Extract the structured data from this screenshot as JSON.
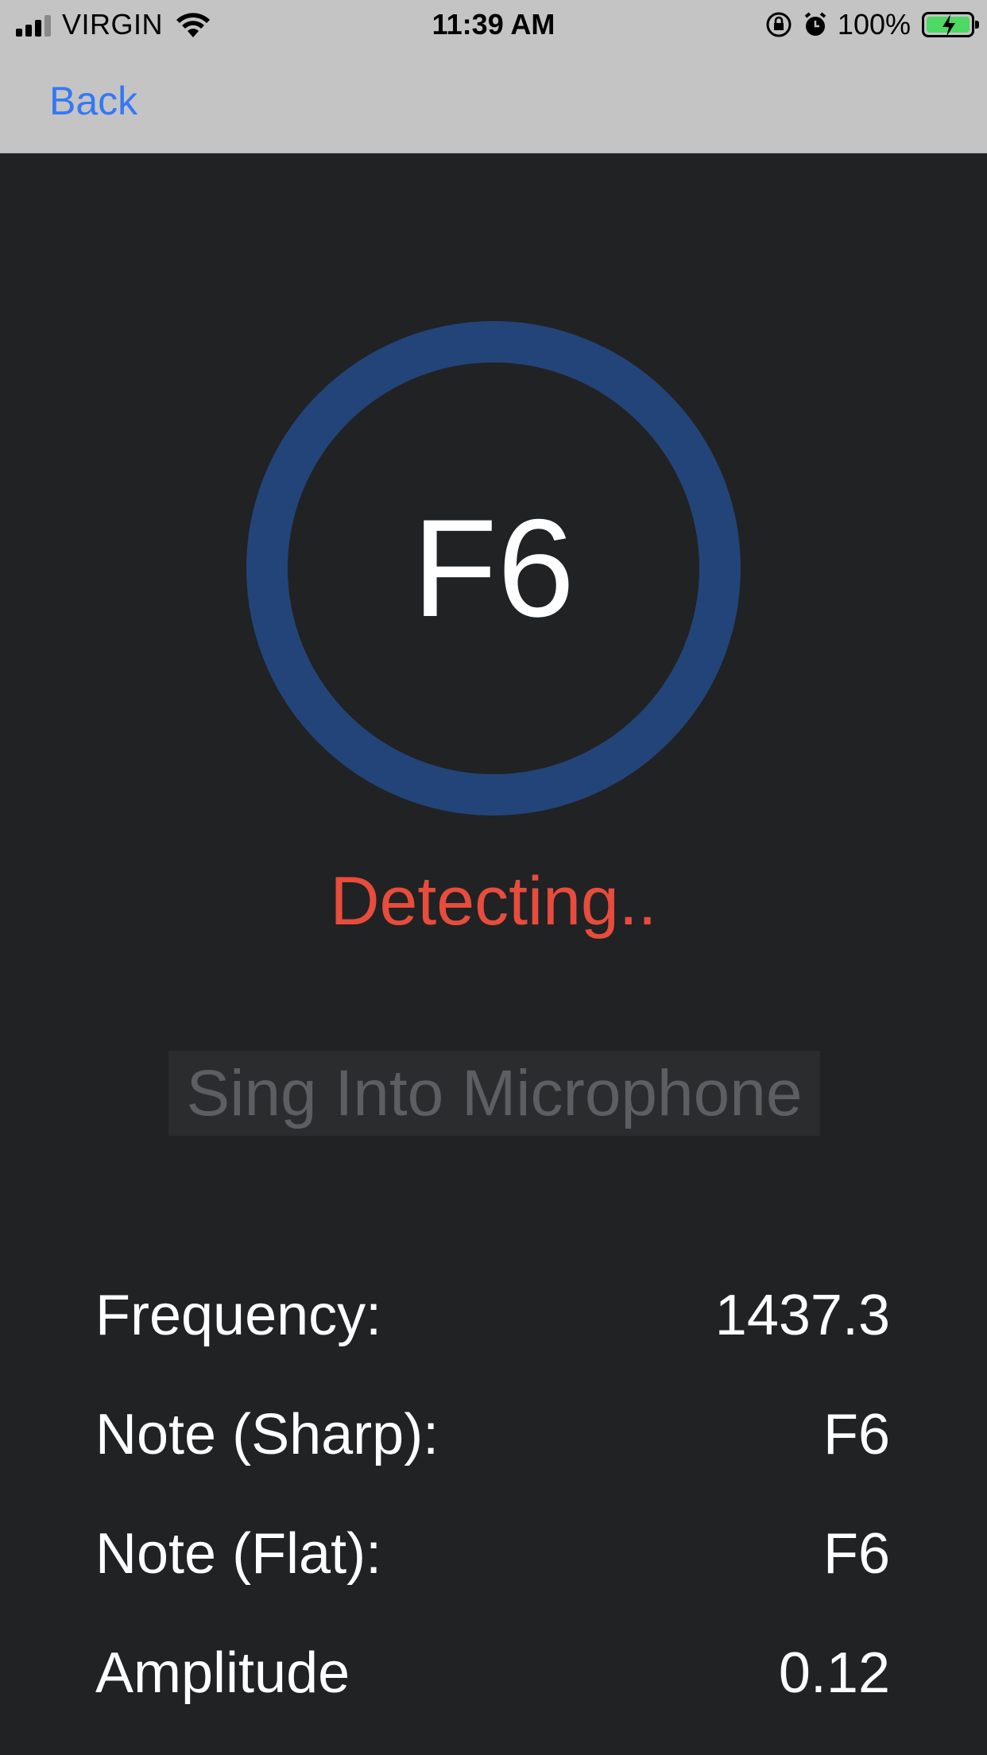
{
  "status_bar": {
    "carrier": "VIRGIN",
    "time": "11:39 AM",
    "battery_percent": "100%",
    "signal_icon": "cellular-signal-icon",
    "wifi_icon": "wifi-icon",
    "rotation_lock_icon": "rotation-lock-icon",
    "alarm_icon": "alarm-icon",
    "battery_icon": "battery-charging-icon"
  },
  "nav": {
    "back_label": "Back"
  },
  "tuner": {
    "note": "F6",
    "ring_color": "#234478",
    "status": "Detecting..",
    "status_color": "#e74c3c",
    "prompt": "Sing Into Microphone"
  },
  "stats": [
    {
      "label": "Frequency:",
      "value": "1437.3"
    },
    {
      "label": "Note (Sharp):",
      "value": "F6"
    },
    {
      "label": "Note (Flat):",
      "value": "F6"
    },
    {
      "label": "Amplitude",
      "value": "0.12"
    }
  ]
}
